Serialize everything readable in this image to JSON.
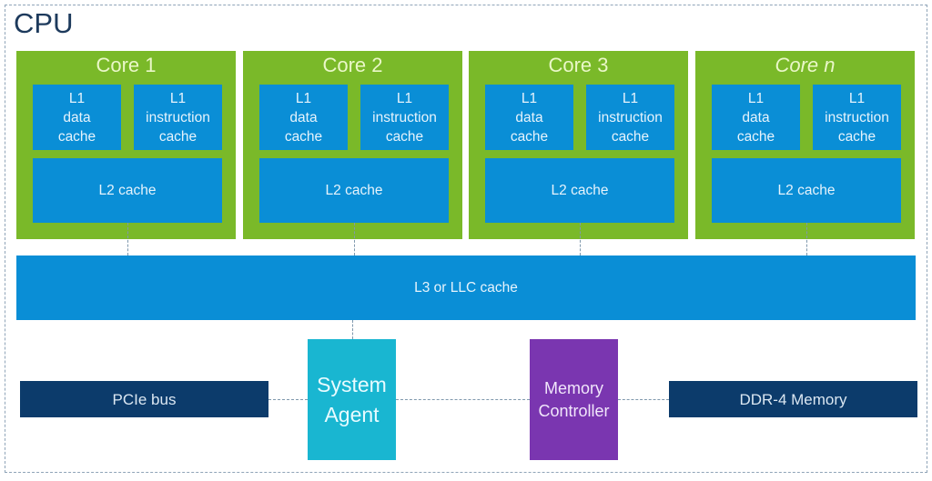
{
  "diagram": {
    "title": "CPU",
    "cores": [
      {
        "name": "Core 1",
        "italic": false,
        "l1_data": "L1\ndata\ncache",
        "l1_instruction": "L1\ninstruction\ncache",
        "l2": "L2 cache"
      },
      {
        "name": "Core 2",
        "italic": false,
        "l1_data": "L1\ndata\ncache",
        "l1_instruction": "L1\ninstruction\ncache",
        "l2": "L2 cache"
      },
      {
        "name": "Core 3",
        "italic": false,
        "l1_data": "L1\ndata\ncache",
        "l1_instruction": "L1\ninstruction\ncache",
        "l2": "L2 cache"
      },
      {
        "name": "Core n",
        "italic": true,
        "l1_data": "L1\ndata\ncache",
        "l1_instruction": "L1\ninstruction\ncache",
        "l2": "L2 cache"
      }
    ],
    "l3": "L3 or LLC cache",
    "pcie": "PCIe bus",
    "system_agent": "System\nAgent",
    "memory_controller": "Memory\nController",
    "ddr": "DDR-4 Memory",
    "colors": {
      "core": "#7ab929",
      "cache": "#0a8ed6",
      "bus": "#0c3b6b",
      "system_agent": "#19b6d1",
      "memory_controller": "#7a36b0",
      "title": "#1d3a5c"
    }
  }
}
